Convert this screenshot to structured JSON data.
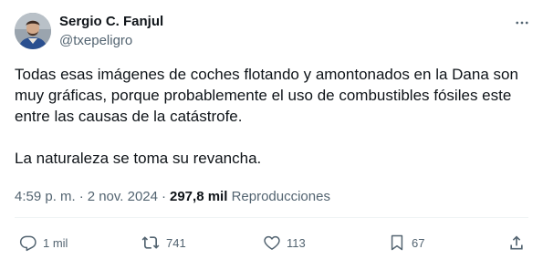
{
  "tweet": {
    "author_name": "Sergio C. Fanjul",
    "author_handle": "@txepeligro",
    "paragraphs": [
      "Todas esas imágenes de coches flotando y amontonados en la Dana son muy gráficas, porque probablemente el uso de combustibles fósiles este entre las causas de la catástrofe.",
      "La naturaleza se toma su revancha."
    ],
    "time": "4:59 p. m.",
    "separator": "·",
    "date": "2 nov. 2024",
    "views_count": "297,8 mil",
    "views_label": "Reproducciones"
  },
  "actions": {
    "reply_count": "1 mil",
    "retweet_count": "741",
    "like_count": "113",
    "bookmark_count": "67"
  },
  "icons": {
    "more": "more-icon",
    "reply": "reply-icon",
    "retweet": "retweet-icon",
    "like": "heart-icon",
    "bookmark": "bookmark-icon",
    "share": "share-icon"
  },
  "colors": {
    "text": "#0f1419",
    "secondary": "#536471",
    "divider": "#eff3f4"
  }
}
